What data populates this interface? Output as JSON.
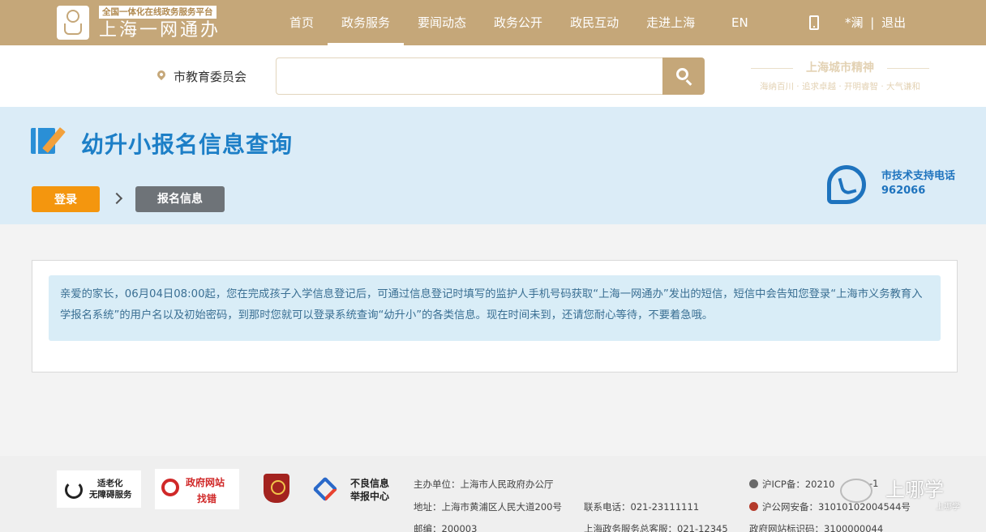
{
  "header": {
    "logo_tagline": "全国一体化在线政务服务平台",
    "logo_name": "上海一网通办",
    "nav": [
      "首页",
      "政务服务",
      "要闻动态",
      "政务公开",
      "政民互动",
      "走进上海"
    ],
    "active_nav": "政务服务",
    "lang": "EN",
    "user": "*澜",
    "separator": "|",
    "logout": "退出"
  },
  "search": {
    "location": "市教育委员会",
    "placeholder": "",
    "spirit_title": "上海城市精神",
    "spirit_sub": "海纳百川 · 追求卓越 · 开明睿智 · 大气谦和"
  },
  "hero": {
    "title": "幼升小报名信息查询",
    "step_login": "登录",
    "step_info": "报名信息",
    "support_label": "市技术支持电话",
    "support_number": "962066"
  },
  "notice": {
    "text": "亲爱的家长，06月04日08:00起，您在完成孩子入学信息登记后，可通过信息登记时填写的监护人手机号码获取“上海一网通办”发出的短信，短信中会告知您登录“上海市义务教育入学报名系统”的用户名以及初始密码，到那时您就可以登录系统查询“幼升小”的各类信息。现在时间未到，还请您耐心等待，不要着急哦。"
  },
  "footer": {
    "badge_a11y": [
      "适老化",
      "无障碍服务"
    ],
    "badge_gov": [
      "政府网站",
      "找错"
    ],
    "badge_report": [
      "不良信息",
      "举报中心"
    ],
    "host": "主办单位：上海市人民政府办公厅",
    "address": "地址：上海市黄浦区人民大道200号",
    "phone": "联系电话：021-23111111",
    "postcode": "邮编：200003",
    "hotline": "上海政务服务总客服：021-12345",
    "icp": "沪ICP备：20210",
    "icp_tail": "-1",
    "security": "沪公网安备：31010102004544号",
    "site_id": "政府网站标识码：3100000044",
    "watermark_name": "上哪学",
    "watermark_sub": "上哪学"
  }
}
